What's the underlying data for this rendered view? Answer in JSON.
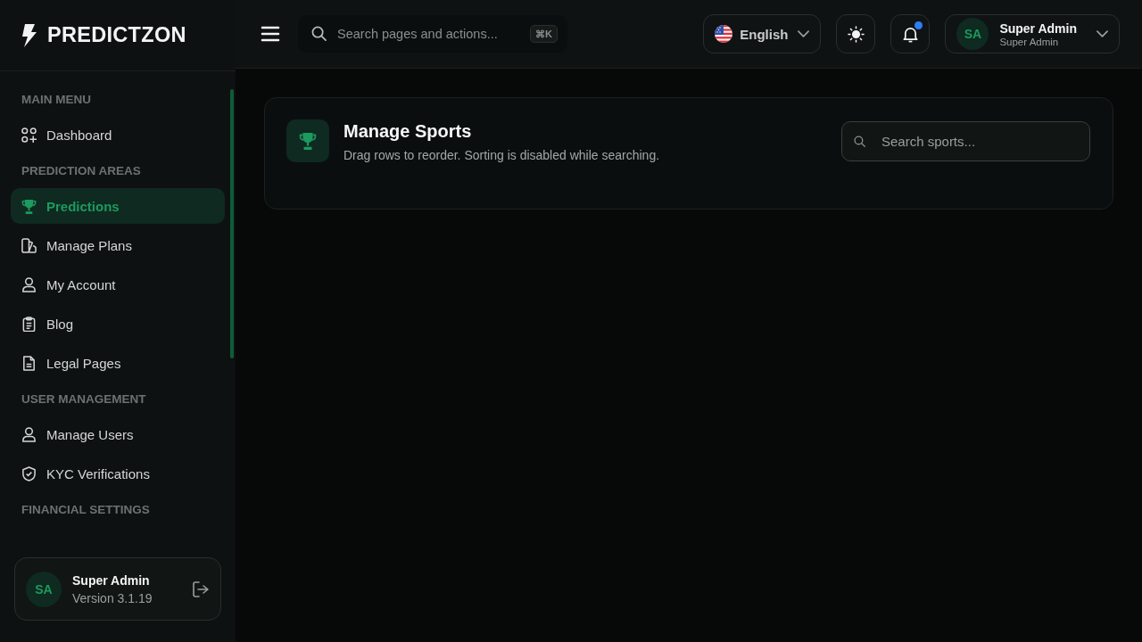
{
  "brand": {
    "name": "PREDICTZON"
  },
  "header": {
    "search": {
      "placeholder": "Search pages and actions...",
      "shortcut": "⌘K"
    },
    "language": {
      "label": "English"
    },
    "notifications": {
      "unread": true
    },
    "user": {
      "initials": "SA",
      "name": "Super Admin",
      "role": "Super Admin"
    }
  },
  "sidebar": {
    "sections": [
      {
        "title": "MAIN MENU",
        "items": [
          {
            "label": "Dashboard",
            "selected": false
          }
        ]
      },
      {
        "title": "PREDICTION AREAS",
        "items": [
          {
            "label": "Predictions",
            "selected": true
          },
          {
            "label": "Manage Plans",
            "selected": false
          },
          {
            "label": "My Account",
            "selected": false
          },
          {
            "label": "Blog",
            "selected": false
          },
          {
            "label": "Legal Pages",
            "selected": false
          }
        ]
      },
      {
        "title": "USER MANAGEMENT",
        "items": [
          {
            "label": "Manage Users",
            "selected": false
          },
          {
            "label": "KYC Verifications",
            "selected": false
          }
        ]
      },
      {
        "title": "FINANCIAL SETTINGS"
      }
    ],
    "footer": {
      "initials": "SA",
      "name": "Super Admin",
      "version": "Version 3.1.19"
    }
  },
  "page": {
    "title": "Manage Sports",
    "subtitle": "Drag rows to reorder. Sorting is disabled while searching.",
    "search": {
      "placeholder": "Search sports..."
    }
  }
}
